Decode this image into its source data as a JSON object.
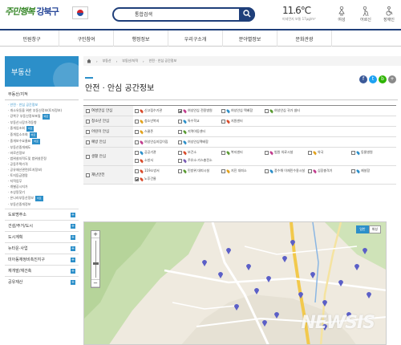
{
  "header": {
    "logo_script": "주민행복",
    "logo_name": "강북구",
    "search_label": "통합검색",
    "temperature": "11.6℃",
    "weather_sub": "미세먼지 보통 17μg/m³",
    "people": [
      "여성",
      "어르신",
      "장애인"
    ]
  },
  "nav": [
    "민원창구",
    "구민참여",
    "행정정보",
    "우리구소개",
    "분야별정보",
    "문화관광"
  ],
  "sidebar": {
    "title": "부동산",
    "section": "부동산/지적",
    "sub_items": [
      {
        "label": "· 안전 · 안심 공간정보",
        "active": true,
        "badge": ""
      },
      {
        "label": "· 개소유동을 위한 부동산정보(토지정보)",
        "active": false,
        "badge": ""
      },
      {
        "label": "· 강북구 부동산정보포털",
        "active": false,
        "badge": "바로"
      },
      {
        "label": "· 부동산시장가격동향",
        "active": false,
        "badge": ""
      },
      {
        "label": "· 중개업조회",
        "active": false,
        "badge": "바로"
      },
      {
        "label": "· 중개업소조회",
        "active": false,
        "badge": "바로"
      },
      {
        "label": "· 중개보수요율표",
        "active": false,
        "badge": "바로"
      },
      {
        "label": "· 부동산중개제도",
        "active": false,
        "badge": ""
      },
      {
        "label": "· 바로선정보",
        "active": false,
        "badge": ""
      },
      {
        "label": "· 범위설지적도및 범위설문정",
        "active": false,
        "badge": ""
      },
      {
        "label": "· 공동주택가격",
        "active": false,
        "badge": ""
      },
      {
        "label": "· 공유재산관련(토지정보)",
        "active": false,
        "badge": ""
      },
      {
        "label": "· 토지등급열람",
        "active": false,
        "badge": ""
      },
      {
        "label": "· 지적업무",
        "active": false,
        "badge": ""
      },
      {
        "label": "· 개별공시지가",
        "active": false,
        "badge": ""
      },
      {
        "label": "· 조상땅찾기",
        "active": false,
        "badge": ""
      },
      {
        "label": "· 온나라부동산정보",
        "active": false,
        "badge": "바로"
      },
      {
        "label": "· 부동산중개정보",
        "active": false,
        "badge": ""
      }
    ],
    "links": [
      "도로명주소",
      "건설/주거/도시",
      "도시계획",
      "뉴타운·사업",
      "미아동재정비촉진지구",
      "재개발/재건축",
      "공유재산"
    ]
  },
  "breadcrumb": [
    "부동산",
    "부동산/지적",
    "안전 · 안심 공간정보"
  ],
  "page_title": "안전 · 안심 공간정보",
  "socials": [
    {
      "glyph": "f",
      "color": "#3b5998"
    },
    {
      "glyph": "t",
      "color": "#1da1f2"
    },
    {
      "glyph": "b",
      "color": "#2db400"
    },
    {
      "glyph": "+",
      "color": "#8a8a8a"
    }
  ],
  "filters": [
    {
      "category": "여성안심 안심",
      "checked": false,
      "options": [
        {
          "label": "신고접수기관",
          "checked": false,
          "color": "#d94b2b"
        },
        {
          "label": "여성안심 전용병원",
          "checked": true,
          "color": "#c13d8e"
        },
        {
          "label": "여성안심 택배함",
          "checked": false,
          "color": "#2c8fc9"
        },
        {
          "label": "여성안심 귀가 쉼터",
          "checked": false,
          "color": "#5a9b32"
        }
      ]
    },
    {
      "category": "청소년 안심",
      "checked": false,
      "options": [
        {
          "label": "청소년복지",
          "checked": false,
          "color": "#e2a21d"
        },
        {
          "label": "특수학교",
          "checked": false,
          "color": "#2c8fc9"
        },
        {
          "label": "지원센터",
          "checked": false,
          "color": "#d94b2b"
        }
      ]
    },
    {
      "category": "어린이 안심",
      "checked": false,
      "options": [
        {
          "label": "스쿨존",
          "checked": false,
          "color": "#e2a21d"
        },
        {
          "label": "지역아동센터",
          "checked": false,
          "color": "#5a9b32"
        }
      ]
    },
    {
      "category": "예방 안심",
      "checked": false,
      "options": [
        {
          "label": "여성안심지킴이집",
          "checked": false,
          "color": "#c13d8e"
        },
        {
          "label": "여성안심택배함",
          "checked": false,
          "color": "#2c8fc9"
        }
      ]
    },
    {
      "category": "생활 안심",
      "checked": false,
      "options": [
        {
          "label": "공공기관",
          "checked": false,
          "color": "#2c8fc9"
        },
        {
          "label": "보건소",
          "checked": false,
          "color": "#d94b2b"
        },
        {
          "label": "복지센터",
          "checked": false,
          "color": "#5a9b32"
        },
        {
          "label": "범원 의료시설",
          "checked": false,
          "color": "#c13d8e"
        },
        {
          "label": "약국",
          "checked": false,
          "color": "#e2a21d"
        },
        {
          "label": "동물병원",
          "checked": false,
          "color": "#2c8fc9"
        },
        {
          "label": "소방서",
          "checked": false,
          "color": "#d94b2b"
        },
        {
          "label": "주유소·가스충전소",
          "checked": false,
          "color": "#7a5bb3"
        }
      ]
    },
    {
      "category": "재난안전",
      "checked": false,
      "options": [
        {
          "label": "119소방서",
          "checked": false,
          "color": "#d94b2b"
        },
        {
          "label": "민방위 대피시설",
          "checked": false,
          "color": "#5a9b32"
        },
        {
          "label": "지진 대피소",
          "checked": false,
          "color": "#e2a21d"
        },
        {
          "label": "풍수해 이재민수용시설",
          "checked": false,
          "color": "#2c8fc9"
        },
        {
          "label": "심장충격기",
          "checked": false,
          "color": "#c13d8e"
        },
        {
          "label": "제설함",
          "checked": false,
          "color": "#2c8fc9"
        },
        {
          "label": "노후건물",
          "checked": true,
          "color": "#d94b2b"
        }
      ]
    }
  ],
  "map": {
    "type_buttons": [
      {
        "label": "일반",
        "active": true
      },
      {
        "label": "위성",
        "active": false
      }
    ],
    "watermark": "NEWSIS"
  }
}
